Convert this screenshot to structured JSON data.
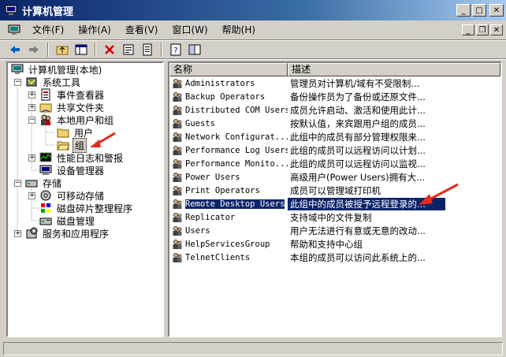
{
  "window": {
    "title": "计算机管理"
  },
  "menu": [
    "文件(F)",
    "操作(A)",
    "查看(V)",
    "窗口(W)",
    "帮助(H)"
  ],
  "tree": {
    "root": "计算机管理(本地)",
    "system_tools": "系统工具",
    "event_viewer": "事件查看器",
    "shared_folders": "共享文件夹",
    "local_users": "本地用户和组",
    "users": "用户",
    "groups": "组",
    "perf_logs": "性能日志和警报",
    "device_manager": "设备管理器",
    "storage": "存储",
    "removable": "可移动存储",
    "defrag": "磁盘碎片整理程序",
    "disk_mgmt": "磁盘管理",
    "services": "服务和应用程序"
  },
  "list": {
    "headers": [
      "名称",
      "描述"
    ],
    "rows": [
      [
        "Administrators",
        "管理员对计算机/域有不受限制..."
      ],
      [
        "Backup Operators",
        "备份操作员为了备份或还原文件..."
      ],
      [
        "Distributed COM Users",
        "成员允许启动、激活和使用此计..."
      ],
      [
        "Guests",
        "按默认值，来宾跟用户组的成员..."
      ],
      [
        "Network Configurat...",
        "此组中的成员有部分管理权限来..."
      ],
      [
        "Performance Log Users",
        "此组的成员可以远程访问以计划..."
      ],
      [
        "Performance Monito...",
        "此组的成员可以远程访问以监视..."
      ],
      [
        "Power Users",
        "高级用户(Power Users)拥有大..."
      ],
      [
        "Print Operators",
        "成员可以管理域打印机"
      ],
      [
        "Remote Desktop Users",
        "此组中的成员被授予远程登录的..."
      ],
      [
        "Replicator",
        "支持域中的文件复制"
      ],
      [
        "Users",
        "用户无法进行有意或无意的改动..."
      ],
      [
        "HelpServicesGroup",
        "帮助和支持中心组"
      ],
      [
        "TelnetClients",
        "本组的成员可以访问此系统上的..."
      ]
    ],
    "selected_index": 9
  },
  "colors": {
    "title_start": "#0a246a",
    "title_end": "#a6caf0",
    "selection": "#0a246a",
    "arrow": "#e8281c"
  }
}
